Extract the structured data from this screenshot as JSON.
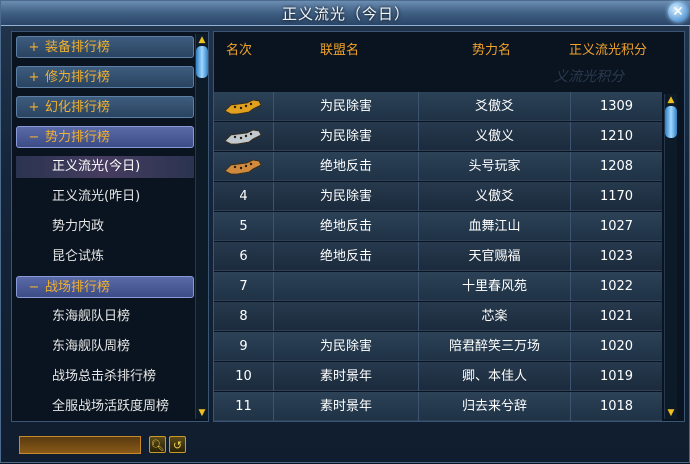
{
  "window": {
    "title": "正义流光（今日）"
  },
  "nav": [
    {
      "type": "category",
      "sign": "+",
      "label": "装备排行榜",
      "open": false
    },
    {
      "type": "category",
      "sign": "+",
      "label": "修为排行榜",
      "open": false
    },
    {
      "type": "category",
      "sign": "+",
      "label": "幻化排行榜",
      "open": false
    },
    {
      "type": "category",
      "sign": "−",
      "label": "势力排行榜",
      "open": true
    },
    {
      "type": "sub",
      "label": "正义流光(今日)",
      "selected": true
    },
    {
      "type": "sub",
      "label": "正义流光(昨日)",
      "selected": false
    },
    {
      "type": "sub",
      "label": "势力内政",
      "selected": false
    },
    {
      "type": "sub",
      "label": "昆仑试炼",
      "selected": false
    },
    {
      "type": "category",
      "sign": "−",
      "label": "战场排行榜",
      "open": true
    },
    {
      "type": "sub",
      "label": "东海舰队日榜",
      "selected": false
    },
    {
      "type": "sub",
      "label": "东海舰队周榜",
      "selected": false
    },
    {
      "type": "sub",
      "label": "战场总击杀排行榜",
      "selected": false
    },
    {
      "type": "sub",
      "label": "全服战场活跃度周榜",
      "selected": false
    }
  ],
  "table": {
    "headers": {
      "rank": "名次",
      "alliance": "联盟名",
      "faction": "势力名",
      "score": "正义流光积分"
    },
    "watermark": "义流光积分",
    "rows": [
      {
        "rank": "",
        "medal": "gold",
        "alliance": "为民除害",
        "faction": "爻傲爻",
        "score": "1309"
      },
      {
        "rank": "",
        "medal": "silver",
        "alliance": "为民除害",
        "faction": "义傲义",
        "score": "1210"
      },
      {
        "rank": "",
        "medal": "bronze",
        "alliance": "绝地反击",
        "faction": "头号玩家",
        "score": "1208"
      },
      {
        "rank": "4",
        "alliance": "为民除害",
        "faction": "义傲爻",
        "score": "1170"
      },
      {
        "rank": "5",
        "alliance": "绝地反击",
        "faction": "血舞江山",
        "score": "1027"
      },
      {
        "rank": "6",
        "alliance": "绝地反击",
        "faction": "天官赐福",
        "score": "1023"
      },
      {
        "rank": "7",
        "alliance": "",
        "faction": "十里春风苑",
        "score": "1022"
      },
      {
        "rank": "8",
        "alliance": "",
        "faction": "芯楽",
        "score": "1021"
      },
      {
        "rank": "9",
        "alliance": "为民除害",
        "faction": "陪君醉笑三万场",
        "score": "1020"
      },
      {
        "rank": "10",
        "alliance": "素时景年",
        "faction": "卿、本佳人",
        "score": "1019"
      },
      {
        "rank": "11",
        "alliance": "素时景年",
        "faction": "归去来兮辞",
        "score": "1018"
      }
    ]
  },
  "search": {
    "value": "",
    "placeholder": ""
  },
  "icons": {
    "close": "close-icon",
    "search": "search-icon",
    "refresh": "refresh-icon"
  },
  "colors": {
    "accent": "#f0a22a",
    "selected": "#463c60",
    "gold": "#e0a020",
    "silver": "#c0c8d0",
    "bronze": "#d08a40"
  }
}
